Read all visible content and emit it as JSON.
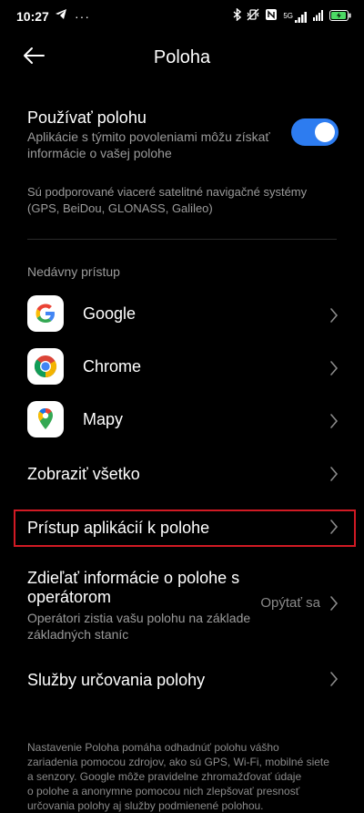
{
  "status_bar": {
    "time": "10:27",
    "network_label": "5G",
    "battery_color": "#4cd964"
  },
  "header": {
    "title": "Poloha",
    "back_icon": "arrow-left-icon"
  },
  "use_location": {
    "title": "Používať polohu",
    "description_line1": "Aplikácie s týmito povoleniami môžu získať",
    "description_line2": "informácie o vašej polohe",
    "enabled": true,
    "accent_color": "#2d7cf0"
  },
  "gnss_note": {
    "line1": "Sú podporované viaceré satelitné navigačné systémy",
    "line2": "(GPS, BeiDou, GLONASS, Galileo)"
  },
  "recent_access": {
    "label": "Nedávny prístup",
    "apps": [
      {
        "label": "Google",
        "icon": "google-icon"
      },
      {
        "label": "Chrome",
        "icon": "chrome-icon"
      },
      {
        "label": "Mapy",
        "icon": "maps-icon"
      }
    ],
    "show_all": "Zobraziť všetko"
  },
  "app_access": {
    "label": "Prístup aplikácií k polohe"
  },
  "operator_share": {
    "title_line1": "Zdieľať informácie o polohe s",
    "title_line2": "operátorom",
    "desc_line1": "Operátori zistia vašu polohu na základe",
    "desc_line2": "základných staníc",
    "value": "Opýtať sa"
  },
  "location_services": {
    "label": "Služby určovania polohy"
  },
  "footer": {
    "line1": "Nastavenie Poloha pomáha odhadnúť polohu vášho",
    "line2": "zariadenia pomocou zdrojov, ako sú GPS, Wi-Fi, mobilné siete",
    "line3": "a senzory. Google môže pravidelne zhromažďovať údaje",
    "line4": "o polohe a anonymne pomocou nich zlepšovať presnosť",
    "line5": "určovania polohy aj služby podmienené polohou."
  }
}
